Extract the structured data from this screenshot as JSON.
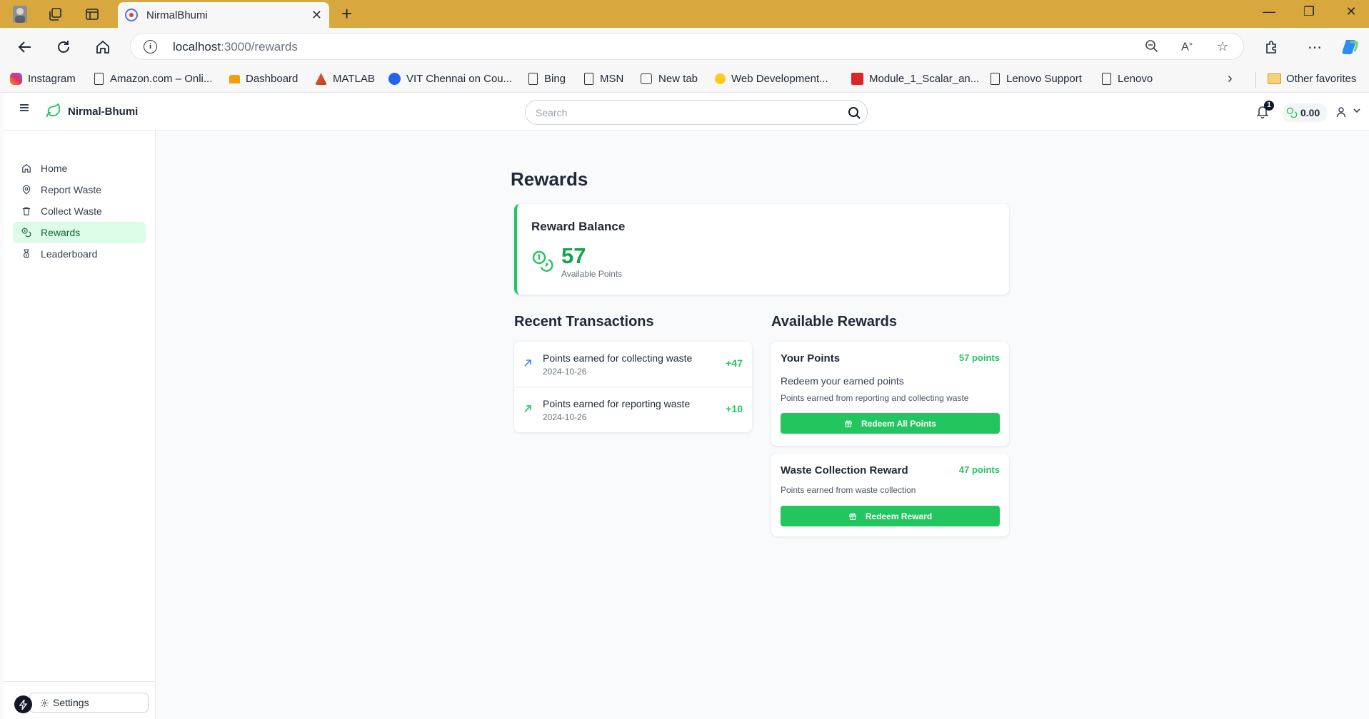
{
  "browser": {
    "tab_title": "NirmalBhumi",
    "url_host": "localhost",
    "url_rest": ":3000/rewards",
    "bookmarks": [
      {
        "label": "Instagram",
        "color": "#e1306c"
      },
      {
        "label": "Amazon.com – Onli...",
        "color": "doc"
      },
      {
        "label": "Dashboard",
        "color": "#f59e0b"
      },
      {
        "label": "MATLAB",
        "color": "#e16737"
      },
      {
        "label": "VIT Chennai on Cou...",
        "color": "#2563eb"
      },
      {
        "label": "Bing",
        "color": "doc"
      },
      {
        "label": "MSN",
        "color": "doc"
      },
      {
        "label": "New tab",
        "color": "doc"
      },
      {
        "label": "Web Development...",
        "color": "#facc15"
      },
      {
        "label": "Module_1_Scalar_an...",
        "color": "#dc2626"
      },
      {
        "label": "Lenovo Support",
        "color": "doc"
      },
      {
        "label": "Lenovo",
        "color": "doc"
      }
    ],
    "other_favorites": "Other favorites"
  },
  "app": {
    "brand": "Nirmal-Bhumi",
    "search_placeholder": "Search",
    "notification_count": "1",
    "header_balance": "0.00"
  },
  "sidebar": {
    "items": [
      {
        "label": "Home",
        "icon": "home-icon"
      },
      {
        "label": "Report Waste",
        "icon": "map-pin-icon"
      },
      {
        "label": "Collect Waste",
        "icon": "trash-icon"
      },
      {
        "label": "Rewards",
        "icon": "coins-icon",
        "active": true
      },
      {
        "label": "Leaderboard",
        "icon": "medal-icon"
      }
    ],
    "settings_label": "Settings"
  },
  "main": {
    "title": "Rewards",
    "balance": {
      "label": "Reward Balance",
      "value": "57",
      "sub": "Available Points"
    },
    "transactions_title": "Recent Transactions",
    "transactions": [
      {
        "desc": "Points earned for collecting waste",
        "date": "2024-10-26",
        "amount": "+47",
        "icon_color": "#3b82f6"
      },
      {
        "desc": "Points earned for reporting waste",
        "date": "2024-10-26",
        "amount": "+10",
        "icon_color": "#22c55e"
      }
    ],
    "rewards_title": "Available Rewards",
    "rewards": [
      {
        "name": "Your Points",
        "points": "57 points",
        "desc": "Redeem your earned points",
        "note": "Points earned from reporting and collecting waste",
        "button": "Redeem All Points"
      },
      {
        "name": "Waste Collection Reward",
        "points": "47 points",
        "note": "Points earned from waste collection",
        "button": "Redeem Reward"
      }
    ]
  },
  "colors": {
    "accent": "#22c55e",
    "accent_dark": "#16a34a",
    "titlebar": "#d8a83e"
  }
}
